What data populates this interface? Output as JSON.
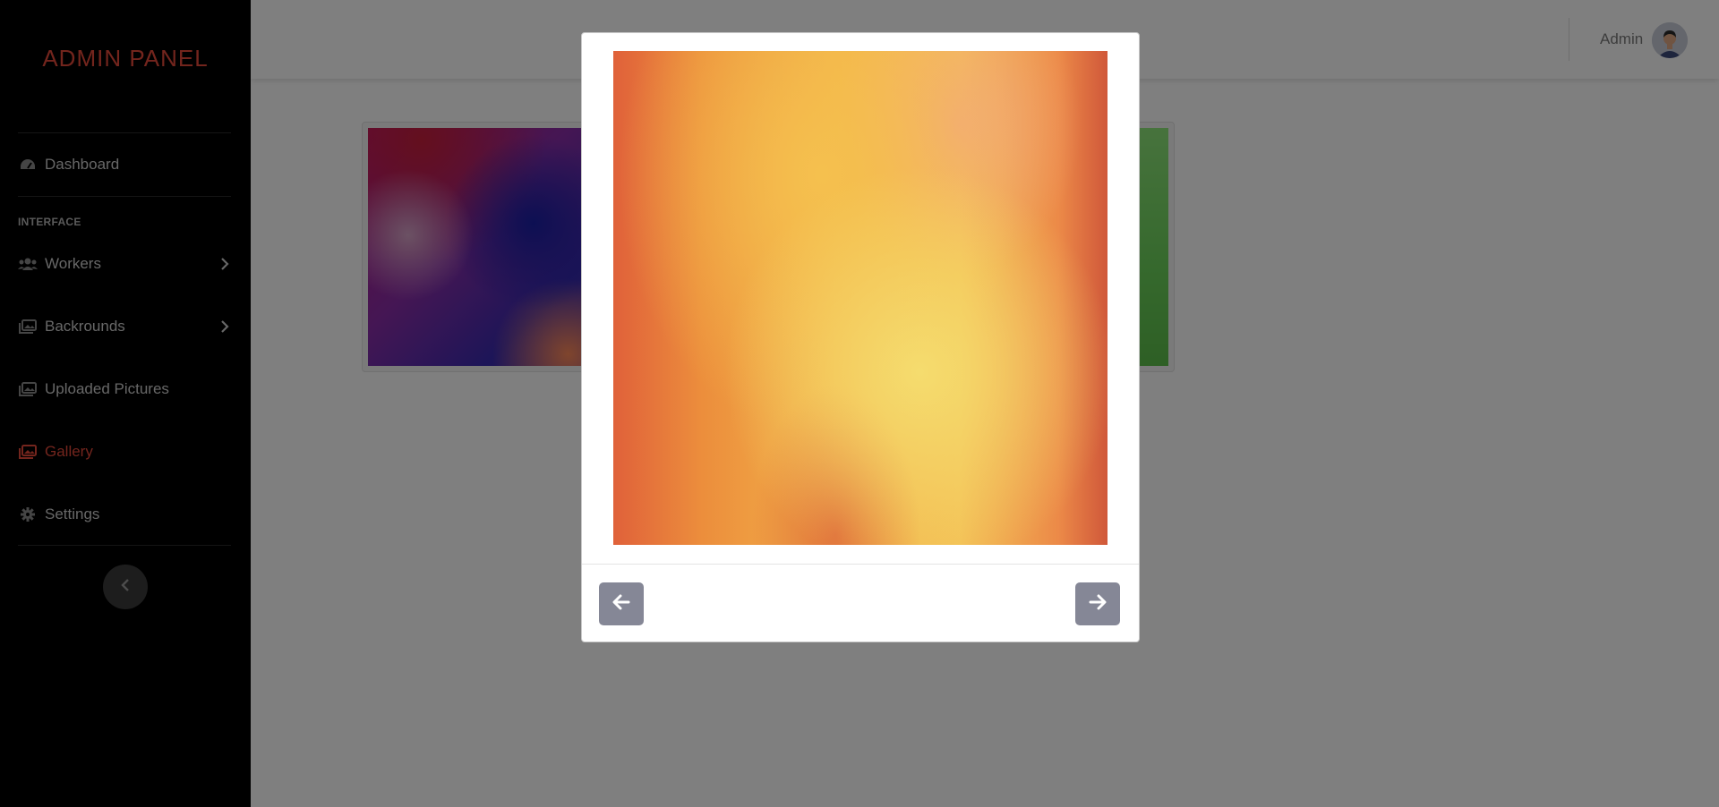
{
  "sidebar": {
    "brand": "ADMIN PANEL",
    "section_label": "INTERFACE",
    "items": [
      {
        "label": "Dashboard",
        "icon": "tachometer-icon"
      },
      {
        "label": "Workers",
        "icon": "users-icon",
        "has_submenu": true
      },
      {
        "label": "Backrounds",
        "icon": "images-icon",
        "has_submenu": true
      },
      {
        "label": "Uploaded Pictures",
        "icon": "images-icon"
      },
      {
        "label": "Gallery",
        "icon": "images-icon",
        "active": true
      },
      {
        "label": "Settings",
        "icon": "gear-icon"
      }
    ],
    "toggle_icon": "chevron-left-icon"
  },
  "topbar": {
    "user_name": "Admin",
    "avatar_icon": "user-avatar"
  },
  "gallery": {
    "thumbnails": [
      "purple-blue-gradient",
      "green-gradient"
    ]
  },
  "modal": {
    "image": "orange-yellow-gradient",
    "prev_icon": "arrow-left-icon",
    "next_icon": "arrow-right-icon"
  },
  "colors": {
    "accent": "#e74a3b",
    "sidebar_bg": "#000000",
    "nav_button": "#858796"
  }
}
